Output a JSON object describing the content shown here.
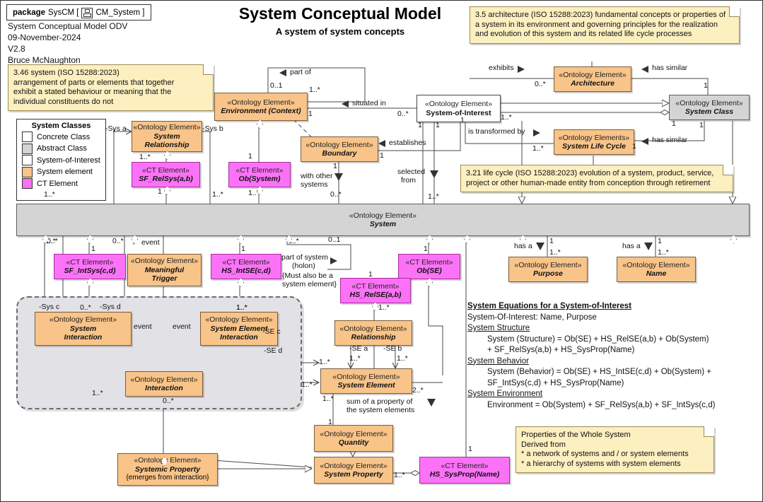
{
  "package": {
    "keyword": "package",
    "name": "SysCM [",
    "icon": "package-icon",
    "suffix": "CM_System ]"
  },
  "meta": {
    "lines": [
      "System Conceptual Model ODV",
      "09-November-2024",
      "V2.8",
      "Bruce McNaughton"
    ]
  },
  "title": {
    "main": "System Conceptual Model",
    "sub": "A system of system concepts"
  },
  "notes": {
    "system_def": "3.46 system (ISO 15288:2023)\narrangement of parts or elements that together\nexhibit a stated behaviour or meaning that the\nindividual constituents do not",
    "system_def_lines": [
      "3.46 system (ISO 15288:2023)",
      "arrangement of parts or elements that together",
      "exhibit a stated behaviour or meaning that the",
      "individual constituents do not"
    ],
    "architecture_def_lines": [
      "3.5 architecture (ISO 15288:2023)  fundamental concepts or properties of",
      "a system in its environment and governing principles for the realization",
      "and evolution of this system and its related life cycle processes"
    ],
    "lifecycle_def_lines": [
      "3.21 life cycle (ISO 15288:2023)  evolution of a system, product, service,",
      "project or other human-made entity from conception through retirement"
    ],
    "whole_system_lines": [
      "Properties of the Whole System",
      "Derived from",
      "   * a network of systems and / or system elements",
      "   * a hierarchy of systems with system elements"
    ]
  },
  "legend": {
    "title": "System Classes",
    "items": [
      {
        "label": "Concrete Class",
        "color": "#ffffff"
      },
      {
        "label": "Abstract Class",
        "color": "#d4d4d4"
      },
      {
        "label": "System-of-Interest",
        "color": "#ffffff"
      },
      {
        "label": "System element",
        "color": "#f8c489"
      },
      {
        "label": "CT Element",
        "color": "#fc6ff8"
      }
    ]
  },
  "stereotypes": {
    "ontology": "«Ontology Element»",
    "ontology_plural": "«Ontology Elements»",
    "ct": "«CT Element»"
  },
  "classes": {
    "environment": {
      "stereotype": "«Ontology Element»",
      "name": "Environment (Context)",
      "kind": "system element"
    },
    "system_relationship": {
      "stereotype": "«Ontology Element»",
      "name": "System\nRelationship",
      "line1": "System",
      "line2": "Relationship",
      "kind": "system element"
    },
    "sf_relsys": {
      "stereotype": "«CT Element»",
      "name": "SF_RelSys(a,b)",
      "kind": "ct"
    },
    "ob_system": {
      "stereotype": "«CT Element»",
      "name": "Ob(System)",
      "kind": "ct"
    },
    "boundary": {
      "stereotype": "«Ontology Element»",
      "name": "Boundary",
      "kind": "system element"
    },
    "system_of_interest": {
      "stereotype": "«Ontology Element»",
      "name": "System-of-Interest",
      "kind": "soi"
    },
    "architecture": {
      "stereotype": "«Ontology Element»",
      "name": "Architecture",
      "kind": "system element"
    },
    "system_class": {
      "stereotype": "«Ontology Element»",
      "name": "System Class",
      "kind": "abstract"
    },
    "system_life_cycle": {
      "stereotype": "«Ontology Elements»",
      "name": "System Life Cycle",
      "kind": "system element"
    },
    "system": {
      "stereotype": "«Ontology Element»",
      "name": "System",
      "kind": "abstract"
    },
    "sf_intsys": {
      "stereotype": "«CT Element»",
      "name": "SF_IntSys(c,d)",
      "kind": "ct"
    },
    "meaningful_trigger": {
      "stereotype": "«Ontology Element»",
      "name": "Meaningful\nTrigger",
      "line1": "Meaningful",
      "line2": "Trigger",
      "kind": "system element"
    },
    "hs_intse": {
      "stereotype": "«CT Element»",
      "name": "HS_IntSE(c,d)",
      "kind": "ct"
    },
    "ob_se": {
      "stereotype": "«CT Element»",
      "name": "Ob(SE)",
      "kind": "ct"
    },
    "hs_relse": {
      "stereotype": "«CT Element»",
      "name": "HS_RelSE(a,b)",
      "kind": "ct"
    },
    "purpose": {
      "stereotype": "«Ontology Element»",
      "name": "Purpose",
      "kind": "system element"
    },
    "name": {
      "stereotype": "«Ontology Element»",
      "name": "Name",
      "kind": "system element"
    },
    "system_interaction": {
      "stereotype": "«Ontology Element»",
      "name": "System\nInteraction",
      "line1": "System",
      "line2": "Interaction",
      "kind": "system element"
    },
    "system_element_interaction": {
      "stereotype": "«Ontology Element»",
      "name": "System Element\nInteraction",
      "line1": "System Element",
      "line2": "Interaction",
      "kind": "system element"
    },
    "interaction": {
      "stereotype": "«Ontology Element»",
      "name": "Interaction",
      "kind": "system element"
    },
    "relationship": {
      "stereotype": "«Ontology Element»",
      "name": "Relationship",
      "kind": "system element"
    },
    "system_element": {
      "stereotype": "«Ontology Element»",
      "name": "System Element",
      "kind": "system element"
    },
    "quantity": {
      "stereotype": "«Ontology Element»",
      "name": "Quantity",
      "kind": "system element"
    },
    "systemic_property": {
      "stereotype": "«Ontology Element»",
      "name": "Systemic Property",
      "constraint": "{emerges from interaction}",
      "kind": "system element"
    },
    "system_property": {
      "stereotype": "«Ontology Element»",
      "name": "System Property",
      "kind": "system element"
    },
    "hs_sysprop": {
      "stereotype": "«CT Element»",
      "name": "HS_SysProp(Name)",
      "kind": "ct"
    }
  },
  "edge_labels": {
    "part_of": "part of",
    "situated_in": "situated in",
    "establishes": "establishes",
    "exhibits": "exhibits",
    "has_similar_1": "has similar",
    "has_similar_2": "has similar",
    "is_transformed_by": "is transformed by",
    "selected_from_1": "selected",
    "selected_from_2": "from",
    "with_other_1": "with other",
    "with_other_2": "systems",
    "sys_a": "-Sys a",
    "sys_b": "-Sys b",
    "sys_c": "-Sys c",
    "sys_d": "-Sys d",
    "se_a": "-SE a",
    "se_b": "-SE b",
    "se_c": "-SE c",
    "se_d": "-SE d",
    "event_1": "event",
    "event_2": "event",
    "event_3": "event",
    "part_of_system_1": "part of system",
    "part_of_system_2": "(holon)",
    "holon_constraint_1": "{Must also be a",
    "holon_constraint_2": "system element}",
    "has_a_1": "has a",
    "has_a_2": "has a",
    "sum_of_1": "sum of a property of",
    "sum_of_2": "the system elements"
  },
  "cardinalities": {
    "c_part_of_src": "0..1",
    "c_part_of_tgt": "1..*",
    "c_env_right": "1",
    "c_soi_situated": "0..*",
    "c_soi_1a": "1",
    "c_soi_1b": "1",
    "c_boundary_1": "1",
    "c_boundary_under": "1",
    "c_boundary_0star": "0..*",
    "c_with_other": "0..*",
    "c_arch_0star": "0..*",
    "c_arch_1": "1",
    "c_sysclass_1": "1",
    "c_sc_right_1": "1",
    "c_slc_1": "1",
    "c_slc_1star": "1..*",
    "c_soi_trans": "1",
    "c_soi_trans_star": "1..*",
    "c_selected_1star": "1..*",
    "c_relsys_1star": "1..*",
    "c_relsys_1": "1",
    "c_env_1": "1",
    "c_obsys_1star_l": "1..*",
    "c_obsys_1star_r": "1..*",
    "c_sysrel_left_1star": "1..*",
    "c_sysrel_right_1star": "1..*",
    "c_sf_intsys_0star": "0..*",
    "c_sf_intsys_1": "1",
    "c_sf_intsys_below": "0..*",
    "c_trigger_0star": "0..*",
    "c_hs_intse_1": "1",
    "c_hs_intse_1star": "1..*",
    "c_holon_1star": "1..*",
    "c_holon_01": "0..1",
    "c_obse_1": "1",
    "c_obse_2star": "2..*",
    "c_hsrelse_1": "1",
    "c_hsrelse_1star": "1..*",
    "c_rel_sea_1star": "1..*",
    "c_rel_seb_1star": "1..*",
    "c_se_left_1star": "1..*",
    "c_se_in_1star": "1..*",
    "c_se_down_1star": "1..*",
    "c_interaction_0star": "0..*",
    "c_interaction_1star": "1..*",
    "c_sei_1star": "1..*",
    "c_purpose_1": "1",
    "c_purpose_1star": "1..*",
    "c_name_1": "1",
    "c_name_1star": "1..*",
    "c_quantity_1": "1",
    "c_sysprop_1star": "1..*",
    "c_hssysprop_1": "1"
  },
  "equations": {
    "heading": "System Equations for a System-of-Interest",
    "soi_line": "System-Of-Interest:  Name, Purpose",
    "structure_head": "System Structure",
    "structure_l1": "System (Structure) = Ob(SE) + HS_RelSE(a,b) + Ob(System)",
    "structure_l2": "+ SF_RelSys(a,b) + HS_SysProp(Name)",
    "behavior_head": "System Behavior",
    "behavior_l1": "System (Behavior) = Ob(SE) + HS_IntSE(c,d) + Ob(System) +",
    "behavior_l2": "SF_IntSys(c,d) + HS_SysProp(Name)",
    "environment_head": "System Environment",
    "environment_l1": "Environment = Ob(System) + SF_RelSys(a,b) + SF_IntSys(c,d)"
  },
  "colors": {
    "system_element": "#F8C489",
    "ct_element": "#FC6FF8",
    "abstract": "#D4D4D4",
    "note": "#FCEFC0",
    "line": "#4a4a4a"
  }
}
